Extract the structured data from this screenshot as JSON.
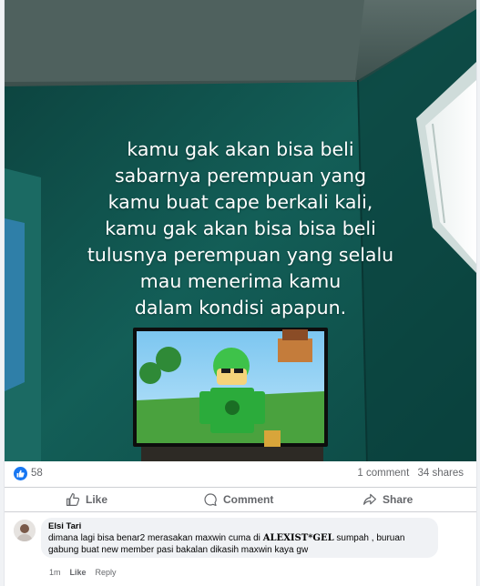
{
  "post": {
    "overlay_lines": [
      "kamu gak akan bisa beli",
      "sabarnya perempuan yang",
      "kamu buat cape berkali kali,",
      "kamu gak akan bisa bisa beli",
      "tulusnya perempuan yang selalu",
      "mau menerima kamu",
      "dalam kondisi apapun."
    ]
  },
  "stats": {
    "reactions": "58",
    "comments": "1 comment",
    "shares": "34 shares"
  },
  "actions": {
    "like": "Like",
    "comment": "Comment",
    "share": "Share"
  },
  "comment": {
    "author": "Elsi Tari",
    "text_before": "dimana lagi bisa benar2 merasakan maxwin cuma di ",
    "text_brand": "ALEXIST*GEL",
    "text_after": " sumpah , buruan gabung buat new member pasi bakalan dikasih maxwin kaya gw",
    "time": "1m",
    "like": "Like",
    "reply": "Reply"
  },
  "colors": {
    "accent": "#1877f2",
    "wall": "#0e4a45"
  },
  "icons": [
    "like-icon",
    "comment-icon",
    "share-icon"
  ]
}
